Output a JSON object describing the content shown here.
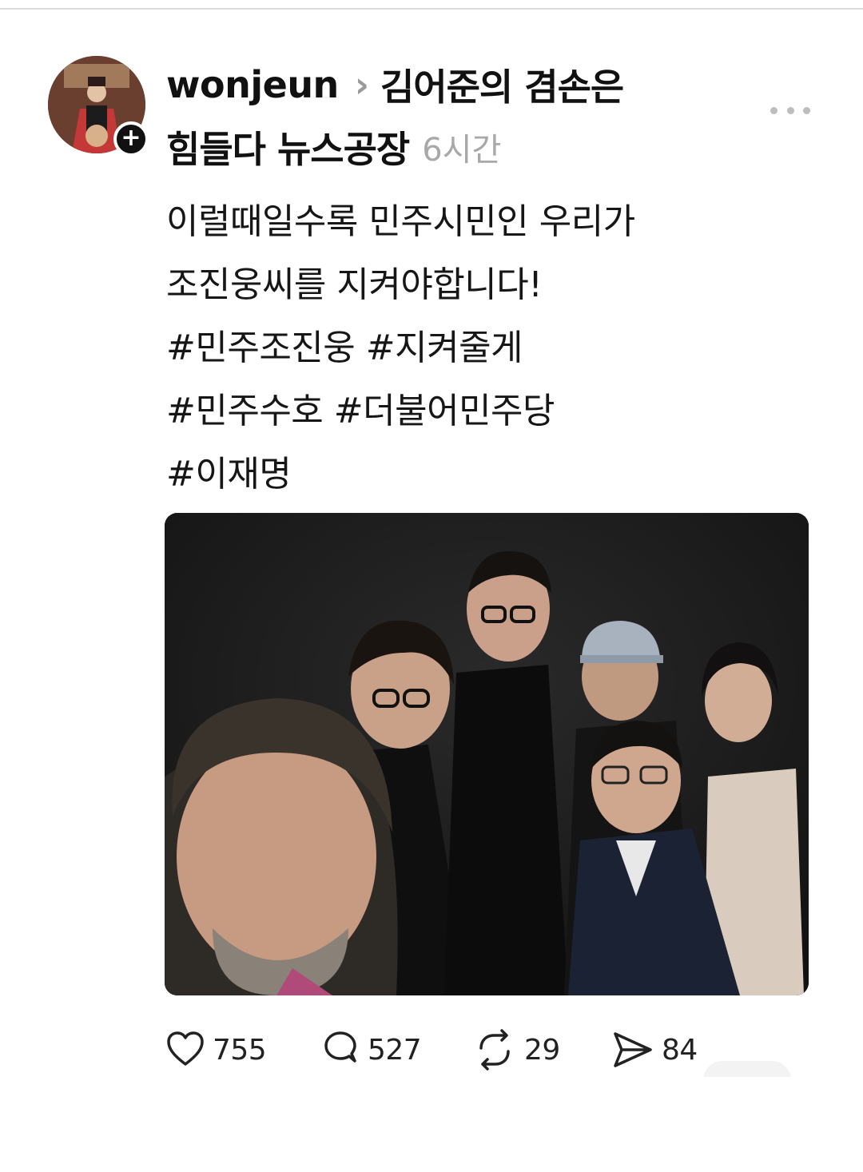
{
  "post": {
    "username": "wonjeun",
    "thread_title_line1": "김어준의 겸손은",
    "thread_title_line2": "힘들다 뉴스공장",
    "time": "6시간",
    "body_lines": [
      "이럴때일수록 민주시민인 우리가",
      "조진웅씨를 지켜야합니다!",
      "#민주조진웅 #지켜줄게",
      "#민주수호 #더불어민주당",
      "#이재명"
    ]
  },
  "actions": {
    "likes": "755",
    "comments": "527",
    "reposts": "29",
    "shares": "84"
  },
  "icons": {
    "follow": "plus-icon",
    "more": "more-horizontal-icon",
    "like": "heart-icon",
    "comment": "comment-bubble-icon",
    "repost": "repost-icon",
    "share": "send-icon"
  },
  "colors": {
    "text": "#111111",
    "muted": "#a8a8a8",
    "photo_background": "#1b1b1b"
  }
}
